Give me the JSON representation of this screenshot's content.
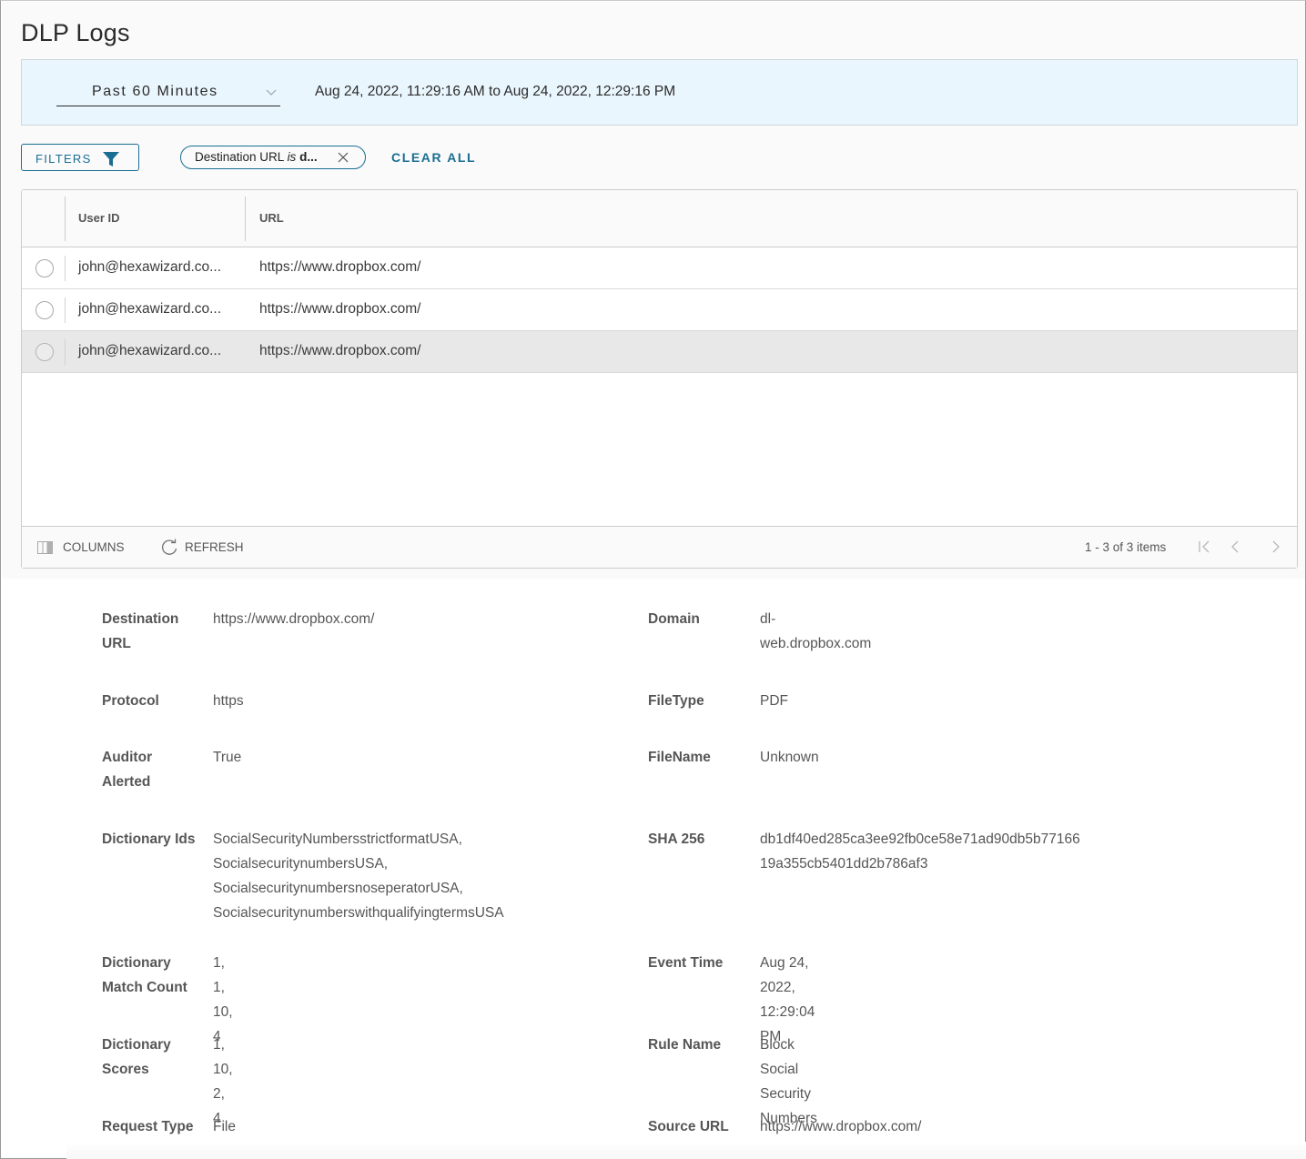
{
  "page": {
    "title": "DLP Logs"
  },
  "time_filter": {
    "selected": "Past 60 Minutes",
    "range_text": "Aug 24, 2022, 11:29:16 AM to Aug 24, 2022, 12:29:16 PM"
  },
  "filters": {
    "button_label": "FILTERS",
    "chip": {
      "field": "Destination URL",
      "operator": "is",
      "value": "d..."
    },
    "clear_all_label": "CLEAR ALL"
  },
  "grid": {
    "columns": [
      "User ID",
      "URL"
    ],
    "rows": [
      {
        "user_id": "john@hexawizard.co...",
        "url": "https://www.dropbox.com/",
        "selected": false
      },
      {
        "user_id": "john@hexawizard.co...",
        "url": "https://www.dropbox.com/",
        "selected": false
      },
      {
        "user_id": "john@hexawizard.co...",
        "url": "https://www.dropbox.com/",
        "selected": true
      }
    ],
    "footer": {
      "columns_label": "COLUMNS",
      "refresh_label": "REFRESH",
      "pagination_text": "1 - 3 of 3 items"
    }
  },
  "details": {
    "left": [
      {
        "label": "Destination URL",
        "value": "https://www.dropbox.com/"
      },
      {
        "label": "Protocol",
        "value": "https"
      },
      {
        "label": "Auditor Alerted",
        "value": "True"
      },
      {
        "label": "Dictionary Ids",
        "value": [
          "SocialSecurityNumbersstrictformatUSA,",
          "SocialsecuritynumbersUSA,",
          "SocialsecuritynumbersnoseperatorUSA,",
          "SocialsecuritynumberswithqualifyingtermsUSA"
        ]
      },
      {
        "label": "Dictionary Match Count",
        "value": "1, 1, 10, 4"
      },
      {
        "label": "Dictionary Scores",
        "value": "1, 10, 2, 4"
      },
      {
        "label": "Request Type",
        "value": "File Upload"
      }
    ],
    "right": [
      {
        "label": "Domain",
        "value": "dl-web.dropbox.com"
      },
      {
        "label": "FileType",
        "value": "PDF"
      },
      {
        "label": "FileName",
        "value": "Unknown"
      },
      {
        "label": "SHA 256",
        "value": [
          "db1df40ed285ca3ee92fb0ce58e71ad90db5b77166",
          "19a355cb5401dd2b786af3"
        ]
      },
      {
        "label": "Event Time",
        "value": "Aug 24, 2022, 12:29:04 PM"
      },
      {
        "label": "Rule Name",
        "value": "Block Social Security Numbers"
      },
      {
        "label": "Source URL",
        "value": "https://www.dropbox.com/"
      }
    ]
  },
  "colors": {
    "accent": "#1a6e92",
    "timebar_bg": "#eaf6fd",
    "selected_row": "#e8e8e8"
  }
}
